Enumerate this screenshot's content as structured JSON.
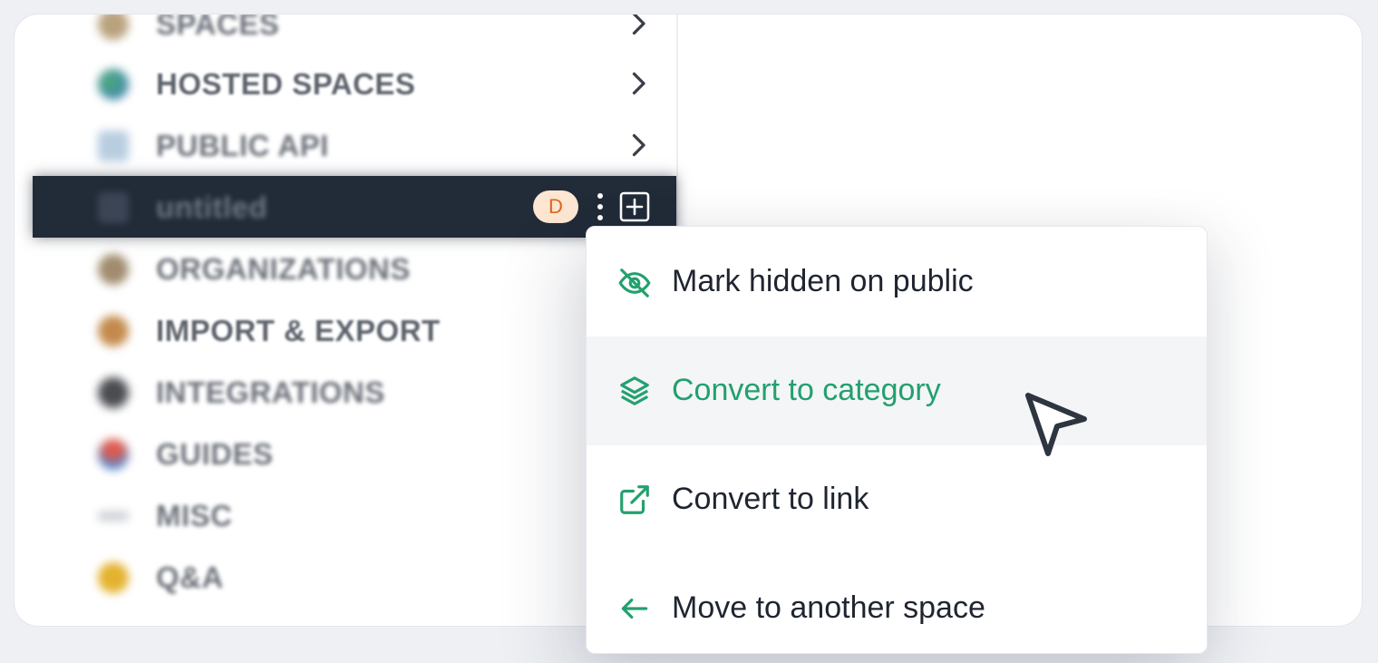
{
  "sidebar": {
    "items": [
      {
        "label": "SPACES"
      },
      {
        "label": "HOSTED SPACES"
      },
      {
        "label": "PUBLIC API"
      },
      {
        "label": "untitled",
        "avatar": "D"
      },
      {
        "label": "ORGANIZATIONS"
      },
      {
        "label": "IMPORT & EXPORT"
      },
      {
        "label": "INTEGRATIONS"
      },
      {
        "label": "GUIDES"
      },
      {
        "label": "MISC"
      },
      {
        "label": "Q&A"
      }
    ]
  },
  "context_menu": {
    "items": [
      {
        "label": "Mark hidden on public",
        "icon": "eye-off-icon"
      },
      {
        "label": "Convert to category",
        "icon": "layers-icon",
        "hovered": true
      },
      {
        "label": "Convert to link",
        "icon": "external-link-icon"
      },
      {
        "label": "Move to another space",
        "icon": "arrow-left-icon"
      }
    ]
  },
  "colors": {
    "accent": "#23a06e",
    "active_row": "#222b38",
    "avatar_bg": "#fde6d2",
    "avatar_text": "#e0661c"
  }
}
